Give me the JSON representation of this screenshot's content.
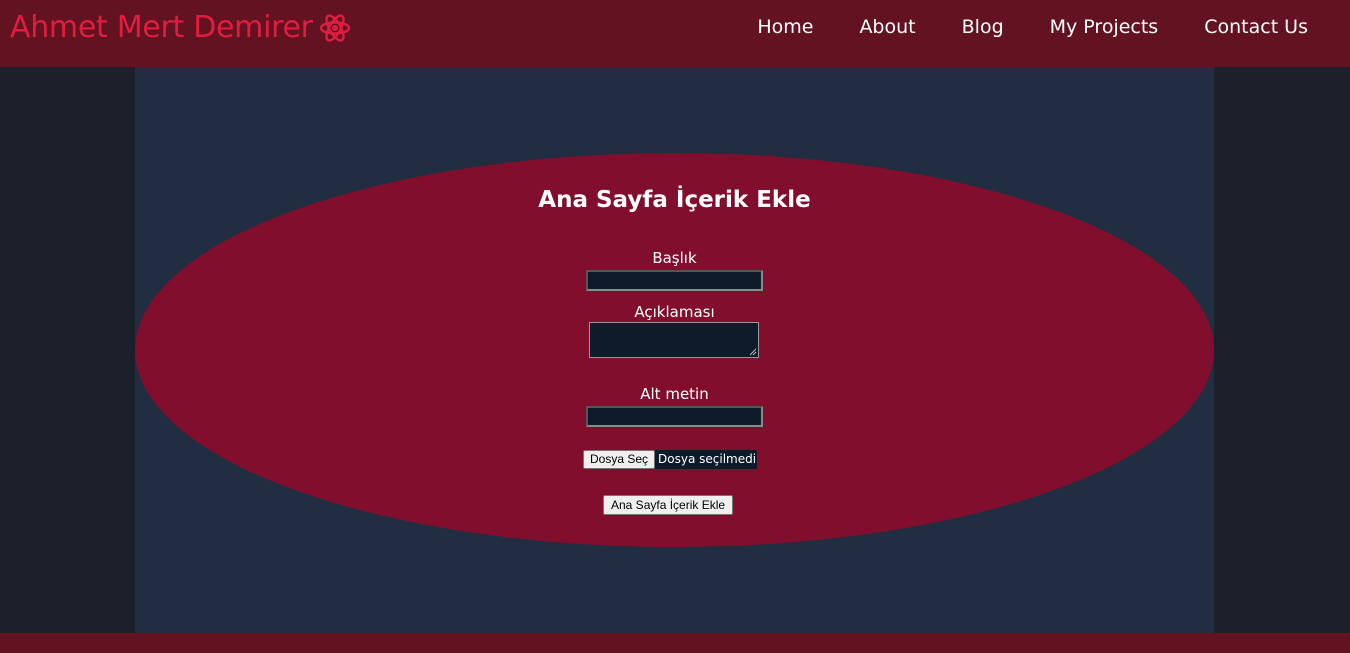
{
  "brand": {
    "name": "Ahmet Mert Demirer",
    "icon": "atom-icon",
    "color": "#e11d3f"
  },
  "nav": {
    "items": [
      {
        "label": "Home"
      },
      {
        "label": "About"
      },
      {
        "label": "Blog"
      },
      {
        "label": "My Projects"
      },
      {
        "label": "Contact Us"
      }
    ]
  },
  "form": {
    "title": "Ana Sayfa İçerik Ekle",
    "title_label": "Başlık",
    "title_value": "",
    "description_label": "Açıklaması",
    "description_value": "",
    "alt_label": "Alt metin",
    "alt_value": "",
    "file_button": "Dosya Seç",
    "file_status": "Dosya seçilmedi",
    "submit_label": "Ana Sayfa İçerik Ekle"
  },
  "colors": {
    "header_bg": "#621220",
    "page_bg": "#1b202b",
    "panel_bg": "#212e42",
    "ellipse_bg": "#820e2e",
    "input_bg": "#0e1b2b"
  }
}
